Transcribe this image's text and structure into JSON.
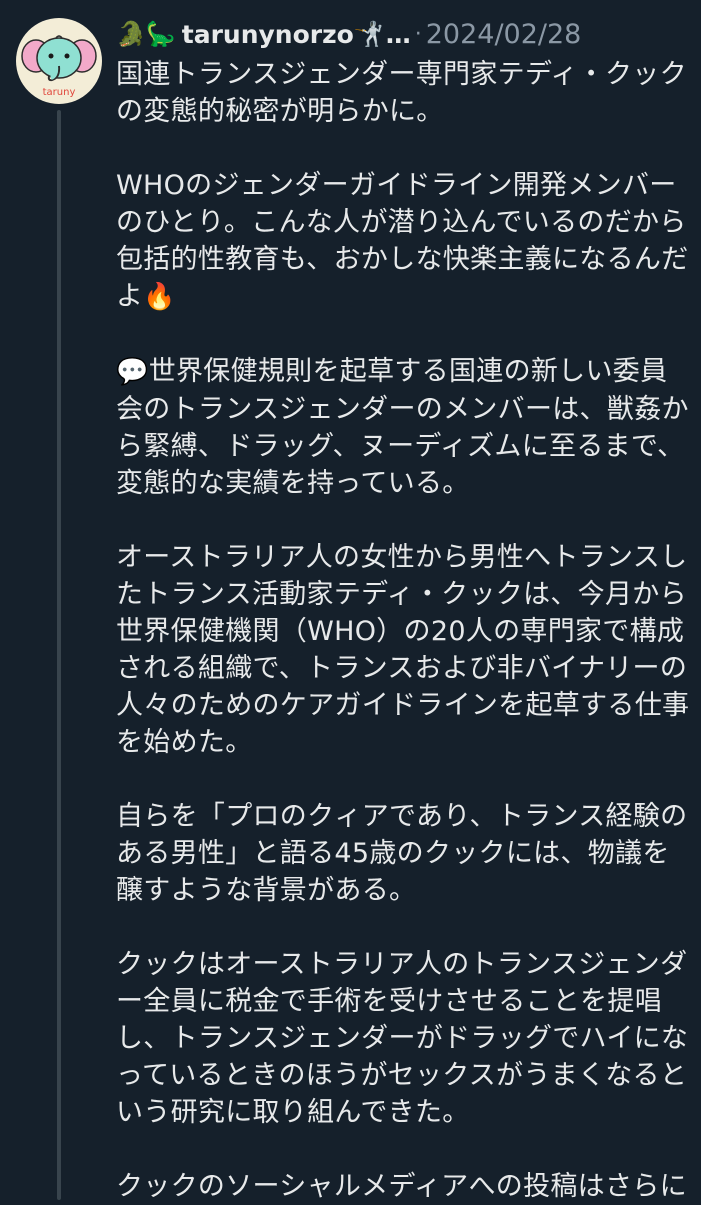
{
  "post": {
    "name_emoji": "🐊🦕",
    "username": "tarunynorzo",
    "username_emoji": "🤺",
    "name_ellipsis": "…",
    "separator": "·",
    "date": "2024/02/28",
    "avatar_label": "taruny",
    "avatar_icon": "elephant-icon",
    "fire_emoji": "🔥",
    "speech_emoji": "💬",
    "paragraphs": [
      {
        "lines": [
          "国連トランスジェンダー専門家テディ・クック",
          "の変態的秘密が明らかに。"
        ]
      },
      {
        "lines": [
          "WHOのジェンダーガイドライン開発メンバー",
          "のひとり。こんな人が潜り込んでいるのだから",
          "包括的性教育も、おかしな快楽主義になるんだ",
          "よ"
        ]
      },
      {
        "lines": [
          "世界保健規則を起草する国連の新しい委員",
          "会のトランスジェンダーのメンバーは、獣姦か",
          "ら緊縛、ドラッグ、ヌーディズムに至るまで、",
          "変態的な実績を持っている。"
        ]
      },
      {
        "lines": [
          "オーストラリア人の女性から男性へトランスし",
          "たトランス活動家テディ・クックは、今月から",
          "世界保健機関（WHO）の20人の専門家で構成",
          "される組織で、トランスおよび非バイナリーの",
          "人々のためのケアガイドラインを起草する仕事",
          "を始めた。"
        ]
      },
      {
        "lines": [
          "自らを「プロのクィアであり、トランス経験の",
          "ある男性」と語る45歳のクックには、物議を",
          "醸すような背景がある。"
        ]
      },
      {
        "lines": [
          "クックはオーストラリア人のトランスジェンダ",
          "ー全員に税金で手術を受けさせることを提唱",
          "し、トランスジェンダーがドラッグでハイにな",
          "っているときのほうがセックスがうまくなると",
          "いう研究に取り組んできた。"
        ]
      },
      {
        "lines": [
          "クックのソーシャルメディアへの投稿はさらに"
        ]
      }
    ]
  },
  "colors": {
    "background": "#15202b",
    "text": "#e7e9ea",
    "muted": "#8b98a5",
    "thread_line": "#38444d",
    "avatar_bg": "#f3edd7",
    "elephant": "#8fe0d2",
    "ear": "#f2a9c9",
    "avatar_label": "#e0473c"
  }
}
